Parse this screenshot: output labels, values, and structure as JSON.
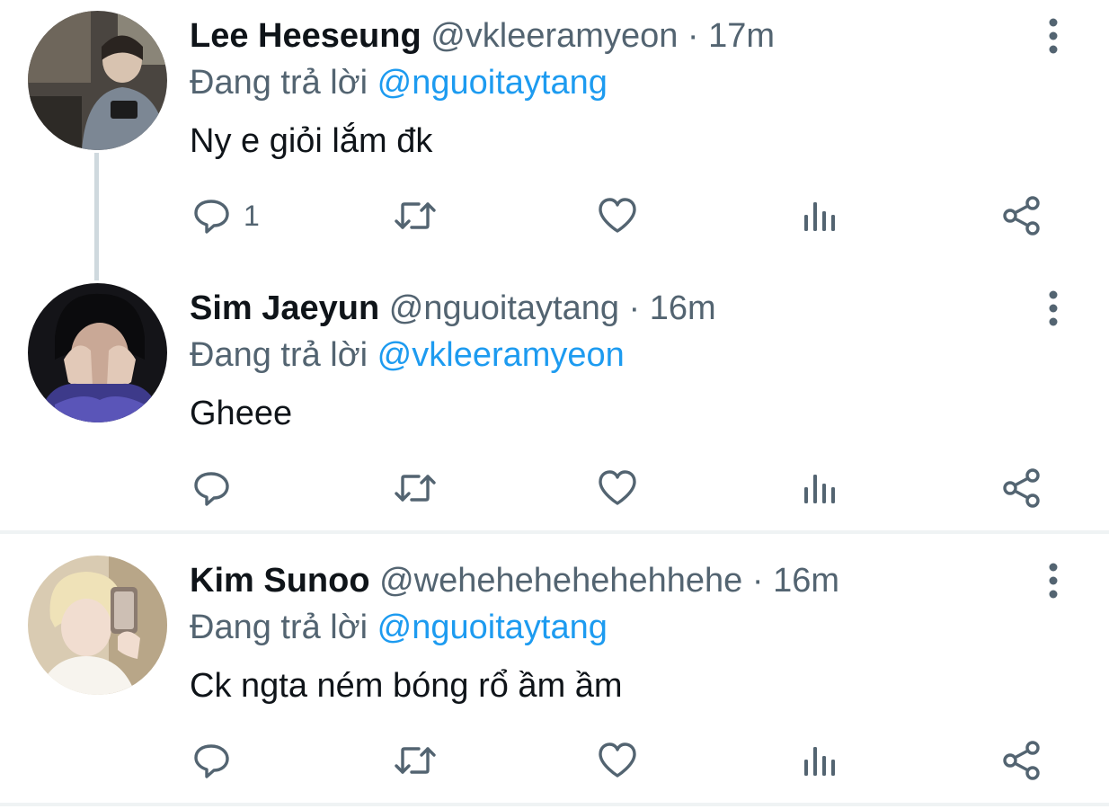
{
  "tweets": [
    {
      "name": "Lee Heeseung",
      "handle": "@vkleeramyeon",
      "separator": "·",
      "time": "17m",
      "replying_prefix": "Đang trả lời",
      "replying_to": "@nguoitaytang",
      "text": "Ny e giỏi lắm đk",
      "reply_count": "1"
    },
    {
      "name": "Sim Jaeyun",
      "handle": "@nguoitaytang",
      "separator": "·",
      "time": "16m",
      "replying_prefix": "Đang trả lời",
      "replying_to": "@vkleeramyeon",
      "text": "Gheee",
      "reply_count": ""
    },
    {
      "name": "Kim Sunoo",
      "handle": "@wehehehehehehhehe",
      "separator": "·",
      "time": "16m",
      "replying_prefix": "Đang trả lời",
      "replying_to": "@nguoitaytang",
      "text": "Ck ngta ném bóng rổ ầm ầm",
      "reply_count": ""
    }
  ],
  "icons": {
    "reply": "reply-icon",
    "retweet": "retweet-icon",
    "like": "like-icon",
    "views": "views-icon",
    "share": "share-icon",
    "more": "more-options-icon"
  },
  "colors": {
    "text": "#0f1419",
    "secondary": "#536471",
    "mention": "#1d9bf0",
    "divider": "#eff3f4",
    "thread_line": "#cfd9de"
  }
}
